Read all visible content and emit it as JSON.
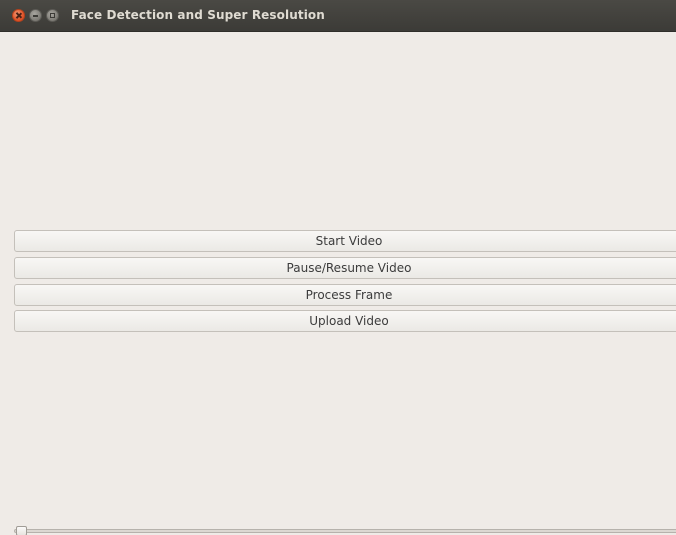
{
  "window": {
    "title": "Face Detection and Super Resolution",
    "controls": [
      "close-icon",
      "minimize-icon",
      "maximize-icon"
    ]
  },
  "buttons": {
    "start": "Start Video",
    "pause": "Pause/Resume Video",
    "process": "Process Frame",
    "upload": "Upload Video"
  },
  "slider": {
    "value_fraction": 0.0
  },
  "colors": {
    "titlebar": "#3c3b37",
    "background": "#efebe7",
    "close_button": "#e2542a"
  }
}
